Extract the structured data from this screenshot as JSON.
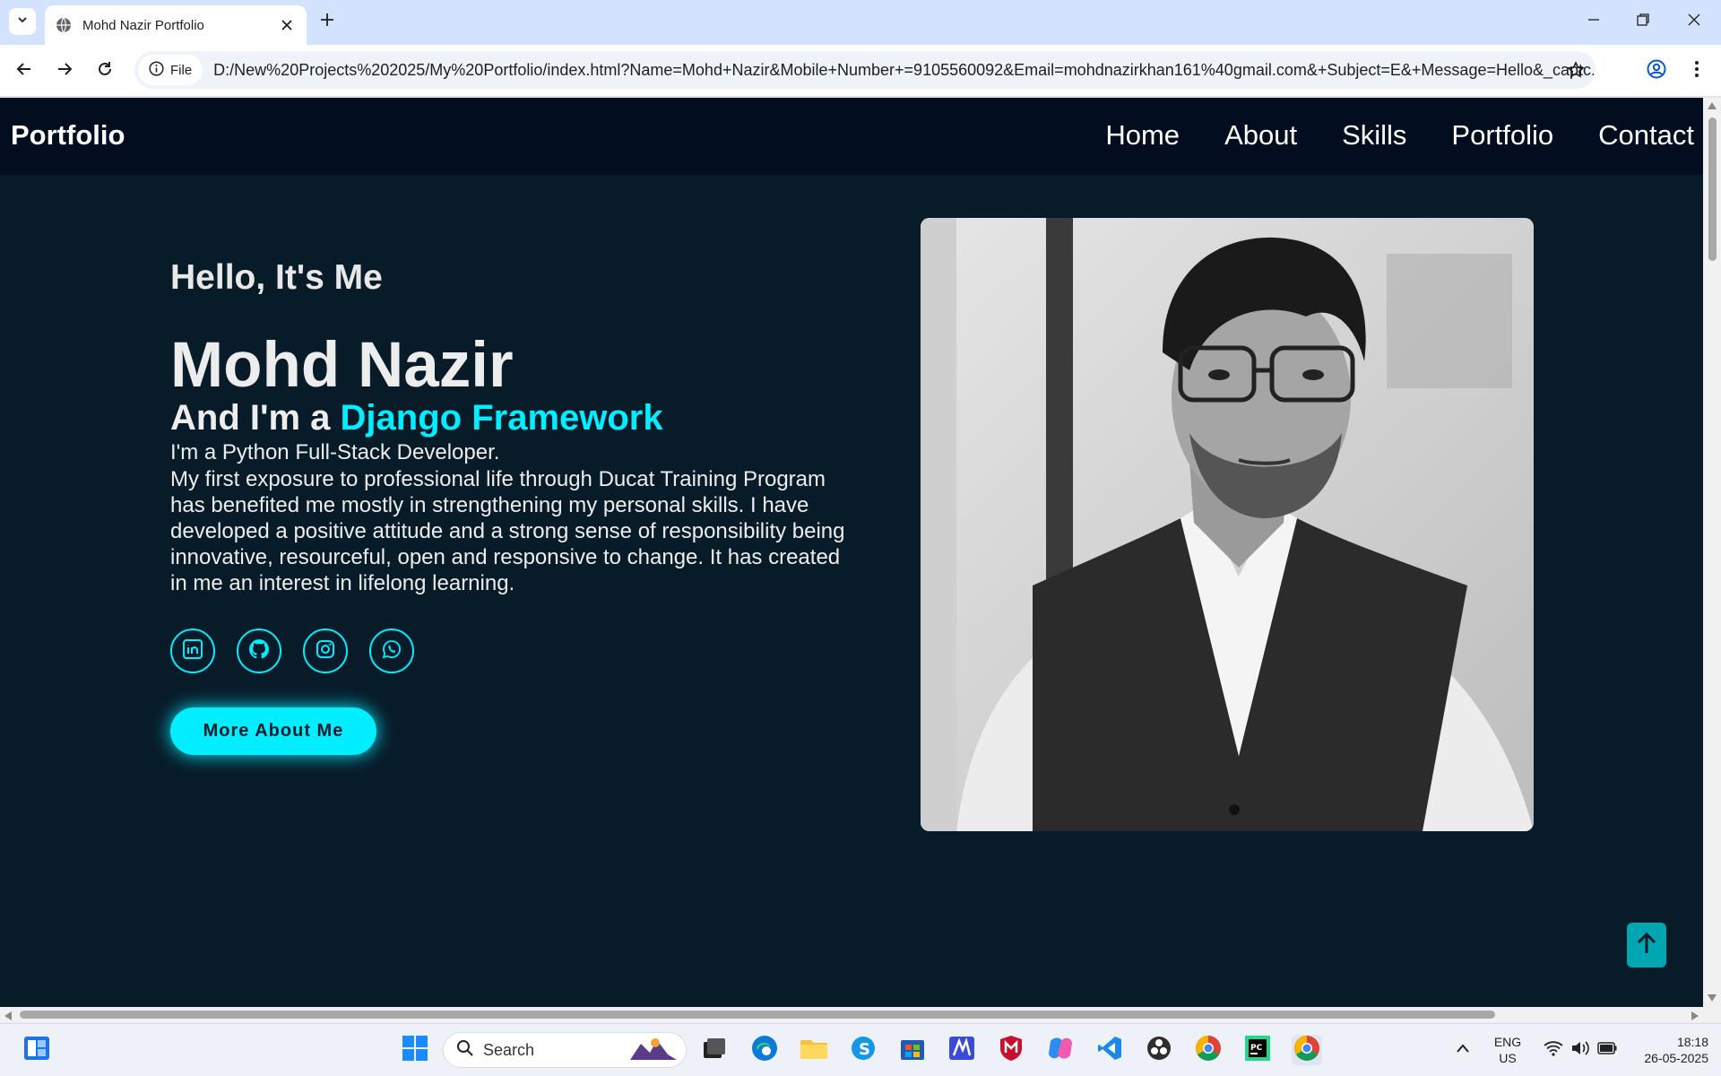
{
  "browser": {
    "tab_title": "Mohd Nazir Portfolio",
    "chip_label": "File",
    "url": "D:/New%20Projects%202025/My%20Portfolio/index.html?Name=Mohd+Nazir&Mobile+Number+=9105560092&Email=mohdnazirkhan161%40gmail.com&+Subject=E&+Message=Hello&_captc..."
  },
  "site": {
    "logo": "Portfolio",
    "nav": [
      "Home",
      "About",
      "Skills",
      "Portfolio",
      "Contact"
    ],
    "greeting": "Hello, It's Me",
    "name": "Mohd Nazir",
    "role_prefix": "And I'm a ",
    "role_accent": "Django Framework",
    "subtitle": "I'm a Python Full-Stack Developer.",
    "bio": "My first exposure to professional life through Ducat Training Program has benefited me mostly in strengthening my personal skills. I have developed a positive attitude and a strong sense of responsibility being innovative, resourceful, open and responsive to change. It has created in me an interest in lifelong learning.",
    "socials": [
      "linkedin-icon",
      "github-icon",
      "instagram-icon",
      "whatsapp-icon"
    ],
    "cta": "More About Me",
    "accent_color": "#00eeff",
    "background_color": "#081b29"
  },
  "taskbar": {
    "search_placeholder": "Search",
    "lang_top": "ENG",
    "lang_bottom": "US",
    "time": "18:18",
    "date": "26-05-2025"
  }
}
